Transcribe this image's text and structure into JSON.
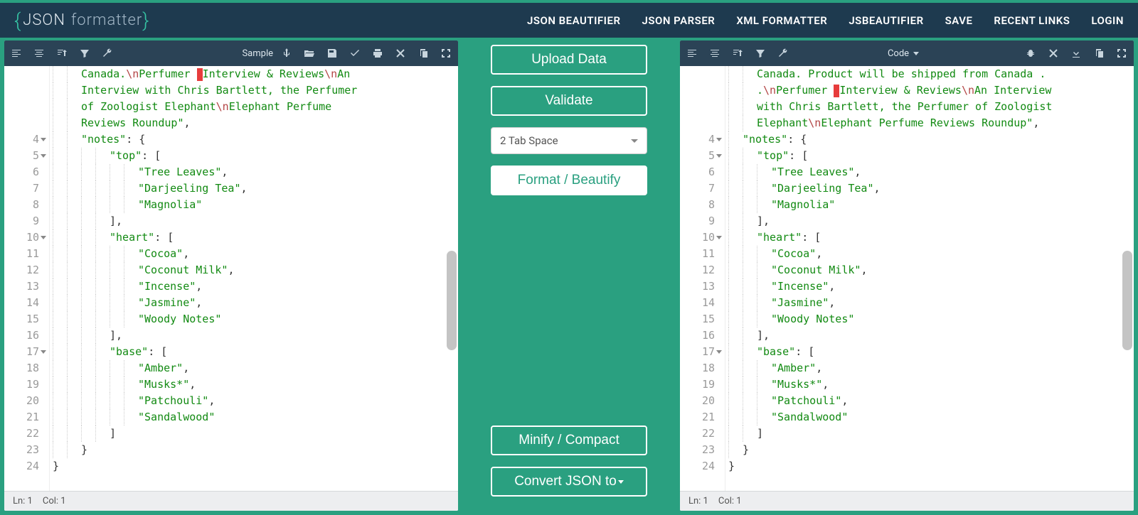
{
  "header": {
    "logo_main": "JSON",
    "logo_sub": "formatter",
    "nav": [
      "JSON BEAUTIFIER",
      "JSON PARSER",
      "XML FORMATTER",
      "JSBEAUTIFIER",
      "SAVE",
      "RECENT LINKS",
      "LOGIN"
    ]
  },
  "left_toolbar": {
    "label": "Sample"
  },
  "right_toolbar": {
    "label": "Code"
  },
  "center": {
    "upload": "Upload Data",
    "validate": "Validate",
    "indent_option": "2 Tab Space",
    "format": "Format / Beautify",
    "minify": "Minify / Compact",
    "convert": "Convert JSON to"
  },
  "status": {
    "ln": "Ln: 1",
    "col": "Col: 1"
  },
  "left_editor": {
    "prefix_text": "Canada.",
    "prefix_rest": "Perfumer ",
    "interview": "Interview & Reviews",
    "an_intro": "An Interview with Chris Bartlett, the Perfumer of Zoologist Elephant",
    "roundup": "Elephant Perfume Reviews Roundup\",",
    "lines": [
      {
        "n": 4,
        "fold": true,
        "indent": 1,
        "text": "\"notes\": {"
      },
      {
        "n": 5,
        "fold": true,
        "indent": 2,
        "text": "\"top\": ["
      },
      {
        "n": 6,
        "fold": false,
        "indent": 3,
        "text": "\"Tree Leaves\","
      },
      {
        "n": 7,
        "fold": false,
        "indent": 3,
        "text": "\"Darjeeling Tea\","
      },
      {
        "n": 8,
        "fold": false,
        "indent": 3,
        "text": "\"Magnolia\""
      },
      {
        "n": 9,
        "fold": false,
        "indent": 2,
        "text": "],"
      },
      {
        "n": 10,
        "fold": true,
        "indent": 2,
        "text": "\"heart\": ["
      },
      {
        "n": 11,
        "fold": false,
        "indent": 3,
        "text": "\"Cocoa\","
      },
      {
        "n": 12,
        "fold": false,
        "indent": 3,
        "text": "\"Coconut Milk\","
      },
      {
        "n": 13,
        "fold": false,
        "indent": 3,
        "text": "\"Incense\","
      },
      {
        "n": 14,
        "fold": false,
        "indent": 3,
        "text": "\"Jasmine\","
      },
      {
        "n": 15,
        "fold": false,
        "indent": 3,
        "text": "\"Woody Notes\""
      },
      {
        "n": 16,
        "fold": false,
        "indent": 2,
        "text": "],"
      },
      {
        "n": 17,
        "fold": true,
        "indent": 2,
        "text": "\"base\": ["
      },
      {
        "n": 18,
        "fold": false,
        "indent": 3,
        "text": "\"Amber\","
      },
      {
        "n": 19,
        "fold": false,
        "indent": 3,
        "text": "\"Musks*\","
      },
      {
        "n": 20,
        "fold": false,
        "indent": 3,
        "text": "\"Patchouli\","
      },
      {
        "n": 21,
        "fold": false,
        "indent": 3,
        "text": "\"Sandalwood\""
      },
      {
        "n": 22,
        "fold": false,
        "indent": 2,
        "text": "]"
      },
      {
        "n": 23,
        "fold": false,
        "indent": 1,
        "text": "}"
      },
      {
        "n": 24,
        "fold": false,
        "indent": 0,
        "text": "}"
      }
    ]
  },
  "right_editor": {
    "prefix_text": "Canada. Product will be shipped from Canada .",
    "perfumer": "Perfumer ",
    "interview": "Interview & Reviews",
    "an_intro": "An Interview with Chris Bartlett, the Perfumer of Zoologist Elephant",
    "roundup": "Elephant Perfume Reviews Roundup\",",
    "lines": [
      {
        "n": 4,
        "fold": true,
        "indent": 1,
        "text": "\"notes\": {"
      },
      {
        "n": 5,
        "fold": true,
        "indent": 2,
        "text": "\"top\": ["
      },
      {
        "n": 6,
        "fold": false,
        "indent": 3,
        "text": "\"Tree Leaves\","
      },
      {
        "n": 7,
        "fold": false,
        "indent": 3,
        "text": "\"Darjeeling Tea\","
      },
      {
        "n": 8,
        "fold": false,
        "indent": 3,
        "text": "\"Magnolia\""
      },
      {
        "n": 9,
        "fold": false,
        "indent": 2,
        "text": "],"
      },
      {
        "n": 10,
        "fold": true,
        "indent": 2,
        "text": "\"heart\": ["
      },
      {
        "n": 11,
        "fold": false,
        "indent": 3,
        "text": "\"Cocoa\","
      },
      {
        "n": 12,
        "fold": false,
        "indent": 3,
        "text": "\"Coconut Milk\","
      },
      {
        "n": 13,
        "fold": false,
        "indent": 3,
        "text": "\"Incense\","
      },
      {
        "n": 14,
        "fold": false,
        "indent": 3,
        "text": "\"Jasmine\","
      },
      {
        "n": 15,
        "fold": false,
        "indent": 3,
        "text": "\"Woody Notes\""
      },
      {
        "n": 16,
        "fold": false,
        "indent": 2,
        "text": "],"
      },
      {
        "n": 17,
        "fold": true,
        "indent": 2,
        "text": "\"base\": ["
      },
      {
        "n": 18,
        "fold": false,
        "indent": 3,
        "text": "\"Amber\","
      },
      {
        "n": 19,
        "fold": false,
        "indent": 3,
        "text": "\"Musks*\","
      },
      {
        "n": 20,
        "fold": false,
        "indent": 3,
        "text": "\"Patchouli\","
      },
      {
        "n": 21,
        "fold": false,
        "indent": 3,
        "text": "\"Sandalwood\""
      },
      {
        "n": 22,
        "fold": false,
        "indent": 2,
        "text": "]"
      },
      {
        "n": 23,
        "fold": false,
        "indent": 1,
        "text": "}"
      },
      {
        "n": 24,
        "fold": false,
        "indent": 0,
        "text": "}"
      }
    ]
  }
}
